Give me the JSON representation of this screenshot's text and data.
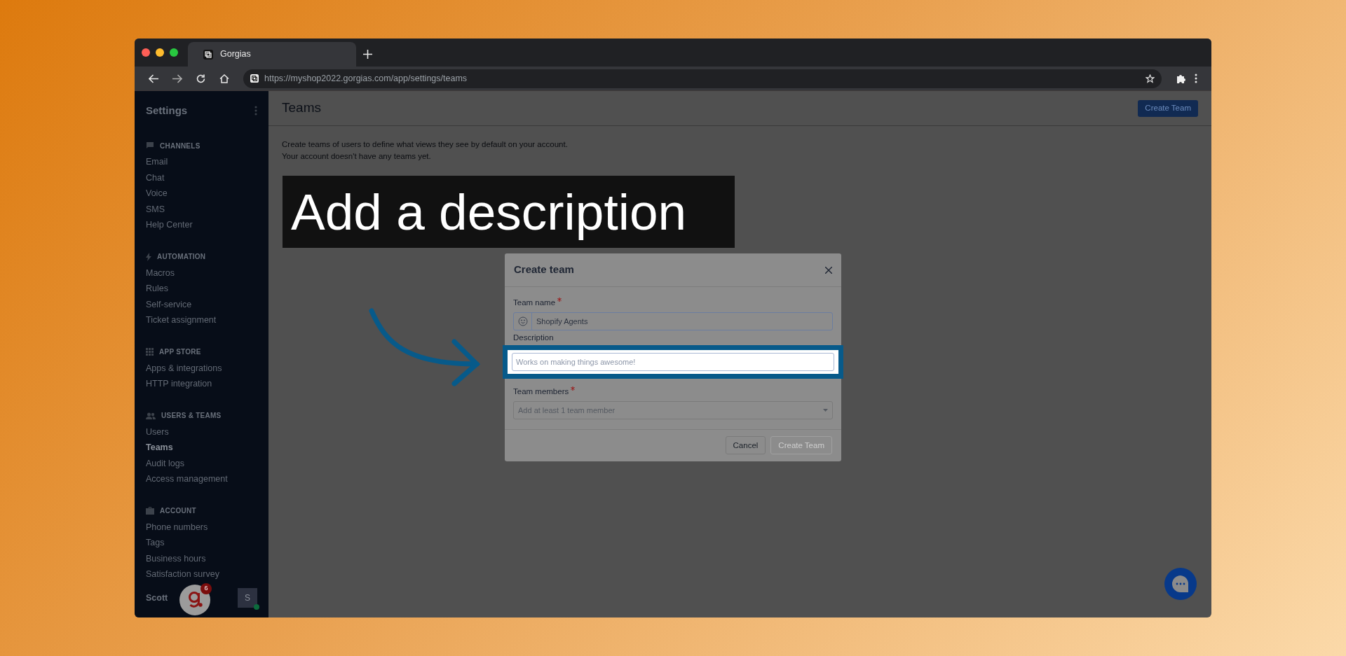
{
  "browser": {
    "tab_title": "Gorgias",
    "url": "https://myshop2022.gorgias.com/app/settings/teams"
  },
  "sidebar": {
    "title": "Settings",
    "sections": [
      {
        "kind": "channels",
        "label": "CHANNELS",
        "items": [
          {
            "label": "Email",
            "selected": false
          },
          {
            "label": "Chat",
            "selected": false
          },
          {
            "label": "Voice",
            "selected": false
          },
          {
            "label": "SMS",
            "selected": false
          },
          {
            "label": "Help Center",
            "selected": false
          }
        ]
      },
      {
        "kind": "automation",
        "label": "AUTOMATION",
        "items": [
          {
            "label": "Macros",
            "selected": false
          },
          {
            "label": "Rules",
            "selected": false
          },
          {
            "label": "Self-service",
            "selected": false
          },
          {
            "label": "Ticket assignment",
            "selected": false
          }
        ]
      },
      {
        "kind": "app_store",
        "label": "APP STORE",
        "items": [
          {
            "label": "Apps & integrations",
            "selected": false
          },
          {
            "label": "HTTP integration",
            "selected": false
          }
        ]
      },
      {
        "kind": "users",
        "label": "USERS & TEAMS",
        "items": [
          {
            "label": "Users",
            "selected": false
          },
          {
            "label": "Teams",
            "selected": true
          },
          {
            "label": "Audit logs",
            "selected": false
          },
          {
            "label": "Access management",
            "selected": false
          }
        ]
      },
      {
        "kind": "account",
        "label": "ACCOUNT",
        "items": [
          {
            "label": "Phone numbers",
            "selected": false
          },
          {
            "label": "Tags",
            "selected": false
          },
          {
            "label": "Business hours",
            "selected": false
          },
          {
            "label": "Satisfaction survey",
            "selected": false
          }
        ]
      }
    ],
    "user_name": "Scott",
    "avatar_initial": "S"
  },
  "page": {
    "title": "Teams",
    "create_button": "Create Team",
    "description": [
      "Create teams of users to define what views they see by default on your account.",
      "Your account doesn't have any teams yet."
    ]
  },
  "caption": "Add a description",
  "modal": {
    "title": "Create team",
    "fields": [
      {
        "kind": "text",
        "label": "Team name",
        "required": true,
        "value": "Shopify Agents",
        "highlighted": false
      },
      {
        "kind": "text",
        "label": "Description",
        "required": false,
        "placeholder": "Works on making things awesome!",
        "highlighted": true
      },
      {
        "kind": "select",
        "label": "Team members",
        "required": true,
        "placeholder": "Add at least 1 team member",
        "highlighted": false
      }
    ],
    "buttons": [
      {
        "label": "Cancel",
        "disabled": false
      },
      {
        "label": "Create Team",
        "disabled": true
      }
    ]
  },
  "launcher_badge": "6"
}
